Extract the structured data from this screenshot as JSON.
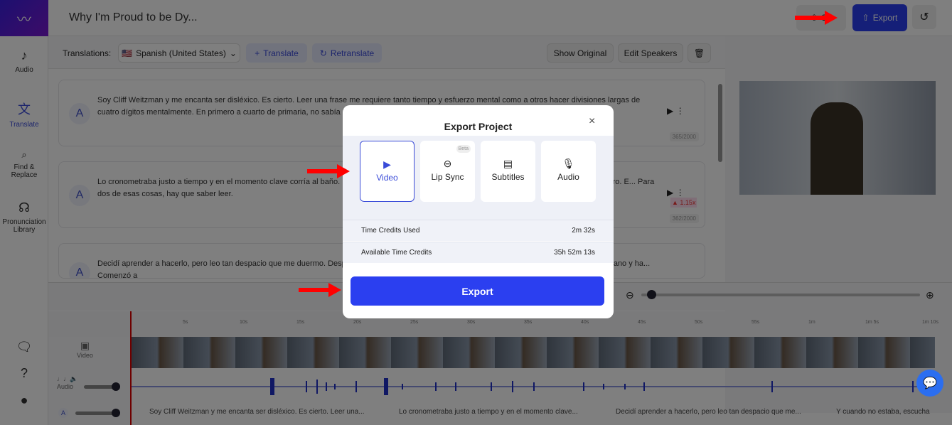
{
  "header": {
    "title": "Why I'm Proud to be Dy...",
    "share_label": "Sh",
    "export_label": "Export"
  },
  "sidebar": {
    "items": [
      {
        "label": "Audio",
        "icon": "music-note-icon"
      },
      {
        "label": "Translate",
        "icon": "translate-icon"
      },
      {
        "label": "Find & Replace",
        "icon": "search-icon"
      },
      {
        "label": "Pronunciation Library",
        "icon": "pronunciation-icon"
      }
    ]
  },
  "toolbar": {
    "translations_label": "Translations:",
    "language": "Spanish (United States)",
    "translate": "Translate",
    "retranslate": "Retranslate",
    "show_original": "Show Original",
    "edit_speakers": "Edit Speakers"
  },
  "segments": [
    {
      "speaker": "A",
      "text": "Soy Cliff Weitzman y me encanta ser disléxico. Es cierto. Leer una frase me requiere tanto tiempo y esfuerzo mental como a otros hacer divisiones largas de cuatro dígitos mentalmente. En primero a cuarto de primaria, no sabía l... lo peor, iban niño por niño hasta llegar a mí.",
      "count": "365/2000"
    },
    {
      "speaker": "A",
      "text": "Lo cronometraba justo a tiempo y en el momento clave corría al baño. E... . Pero realmente quería aprender a leer, lo soñaba. Siempre llevaba un libro. E... Para dos de esas cosas, hay que saber leer.",
      "count": "362/2000",
      "warning": "1.15x"
    },
    {
      "speaker": "A",
      "text": "Decidí aprender a hacerlo, pero leo tan despacio que me duermo. Desp... padre no lo hizo. Nunca se rindió conmigo. Aunque trabajaba, volvía temprano y ha... Comenzó a"
    }
  ],
  "modal": {
    "title": "Export Project",
    "options": [
      {
        "label": "Video",
        "selected": true
      },
      {
        "label": "Lip Sync",
        "badge": "Beta"
      },
      {
        "label": "Subtitles"
      },
      {
        "label": "Audio"
      }
    ],
    "credits_used_label": "Time Credits Used",
    "credits_used": "2m 32s",
    "available_label": "Available Time Credits",
    "available": "35h 52m 13s",
    "export_button": "Export"
  },
  "timeline": {
    "ticks": [
      "5s",
      "10s",
      "15s",
      "20s",
      "25s",
      "30s",
      "35s",
      "40s",
      "45s",
      "50s",
      "55s",
      "1m",
      "1m 5s",
      "1m 10s"
    ],
    "video_label": "Video",
    "audio_label": "Audio",
    "speaker": "A",
    "subtitles": [
      "Soy Cliff Weitzman y me encanta ser disléxico. Es cierto. Leer una...",
      "Lo cronometraba justo a tiempo y en el momento clave...",
      "Decidí aprender a hacerlo, pero leo tan despacio que me...",
      "Y cuando no estaba, escucha"
    ]
  },
  "colors": {
    "accent": "#2b3ff0",
    "arrow": "#ff0000"
  }
}
